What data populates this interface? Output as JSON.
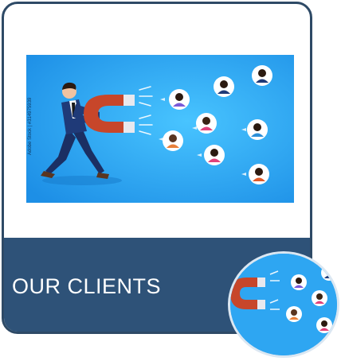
{
  "card": {
    "title": "OUR CLIENTS",
    "image_watermark": "Adobe Stock | #314975939"
  },
  "icons": {
    "hero": "businessman-magnet-attracting-customers-illustration",
    "thumbnail": "magnet-customers-thumbnail"
  },
  "colors": {
    "card_border": "#2e4a66",
    "banner": "#2e5278",
    "sky": "#2ea6f2",
    "magnet": "#c7462a"
  }
}
